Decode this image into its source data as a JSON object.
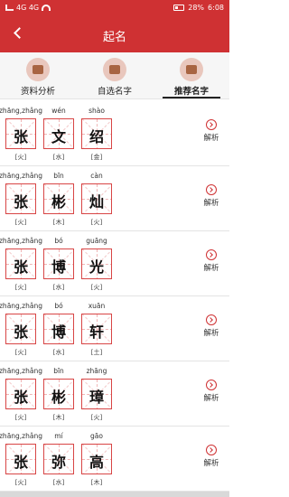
{
  "statusbar": {
    "left": "4G 4G",
    "battery": "28%",
    "time": "6:08"
  },
  "header": {
    "title": "起名"
  },
  "tabs": [
    {
      "label": "资料分析",
      "icon": "book-icon",
      "active": false
    },
    {
      "label": "自选名字",
      "icon": "brush-icon",
      "active": false
    },
    {
      "label": "推荐名字",
      "icon": "seal-icon",
      "active": true
    }
  ],
  "names": [
    {
      "chars": [
        {
          "pinyin": "zhāng,zhǎng",
          "char": "张",
          "element": "[火]"
        },
        {
          "pinyin": "wén",
          "char": "文",
          "element": "[水]"
        },
        {
          "pinyin": "shào",
          "char": "绍",
          "element": "[金]"
        }
      ],
      "action": "解析"
    },
    {
      "chars": [
        {
          "pinyin": "zhāng,zhǎng",
          "char": "张",
          "element": "[火]"
        },
        {
          "pinyin": "bīn",
          "char": "彬",
          "element": "[木]"
        },
        {
          "pinyin": "càn",
          "char": "灿",
          "element": "[火]"
        }
      ],
      "action": "解析"
    },
    {
      "chars": [
        {
          "pinyin": "zhāng,zhǎng",
          "char": "张",
          "element": "[火]"
        },
        {
          "pinyin": "bó",
          "char": "博",
          "element": "[水]"
        },
        {
          "pinyin": "guāng",
          "char": "光",
          "element": "[火]"
        }
      ],
      "action": "解析"
    },
    {
      "chars": [
        {
          "pinyin": "zhāng,zhǎng",
          "char": "张",
          "element": "[火]"
        },
        {
          "pinyin": "bó",
          "char": "博",
          "element": "[水]"
        },
        {
          "pinyin": "xuān",
          "char": "轩",
          "element": "[土]"
        }
      ],
      "action": "解析"
    },
    {
      "chars": [
        {
          "pinyin": "zhāng,zhǎng",
          "char": "张",
          "element": "[火]"
        },
        {
          "pinyin": "bīn",
          "char": "彬",
          "element": "[木]"
        },
        {
          "pinyin": "zhāng",
          "char": "璋",
          "element": "[火]"
        }
      ],
      "action": "解析"
    },
    {
      "chars": [
        {
          "pinyin": "zhāng,zhǎng",
          "char": "张",
          "element": "[火]"
        },
        {
          "pinyin": "mí",
          "char": "弥",
          "element": "[水]"
        },
        {
          "pinyin": "gāo",
          "char": "高",
          "element": "[木]"
        }
      ],
      "action": "解析"
    }
  ],
  "colors": {
    "accent": "#cf3133",
    "grid": "#d84545"
  }
}
